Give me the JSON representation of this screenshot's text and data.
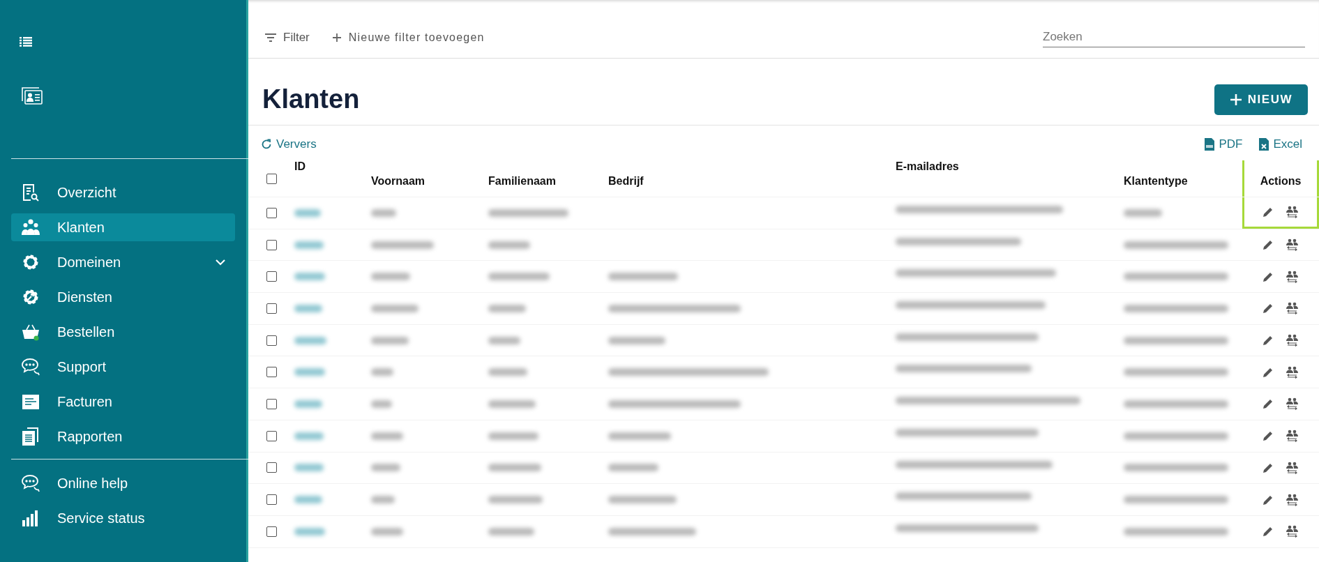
{
  "sidebar": {
    "main_items": [
      {
        "label": "Overzicht",
        "selected": false
      },
      {
        "label": "Klanten",
        "selected": true
      },
      {
        "label": "Domeinen",
        "selected": false,
        "expandable": true
      },
      {
        "label": "Diensten",
        "selected": false
      },
      {
        "label": "Bestellen",
        "selected": false
      },
      {
        "label": "Support",
        "selected": false
      },
      {
        "label": "Facturen",
        "selected": false
      },
      {
        "label": "Rapporten",
        "selected": false
      }
    ],
    "footer_items": [
      {
        "label": "Online help",
        "selected": false
      },
      {
        "label": "Service status",
        "selected": false
      }
    ]
  },
  "filter_bar": {
    "filter": "Filter",
    "add_filter": "Nieuwe filter toevoegen",
    "search": {
      "placeholder": "Zoeken"
    }
  },
  "page": {
    "title": "Klanten",
    "new_button": "NIEUW",
    "refresh": "Ververs",
    "exports": [
      "PDF",
      "Excel"
    ]
  },
  "table": {
    "columns": [
      "ID",
      "Voornaam",
      "Familienaam",
      "Bedrijf",
      "E-mailadres",
      "Klantentype",
      "Actions"
    ],
    "actions_highlighted": true,
    "all_checked": false,
    "rows": [
      {
        "checked": false,
        "has_company": false
      },
      {
        "checked": false,
        "has_company": false
      },
      {
        "checked": false,
        "has_company": true
      },
      {
        "checked": false,
        "has_company": true
      },
      {
        "checked": false,
        "has_company": true
      },
      {
        "checked": false,
        "has_company": true
      },
      {
        "checked": false,
        "has_company": true
      },
      {
        "checked": false,
        "has_company": true
      },
      {
        "checked": false,
        "has_company": true
      },
      {
        "checked": false,
        "has_company": true
      },
      {
        "checked": false,
        "has_company": true
      }
    ]
  }
}
